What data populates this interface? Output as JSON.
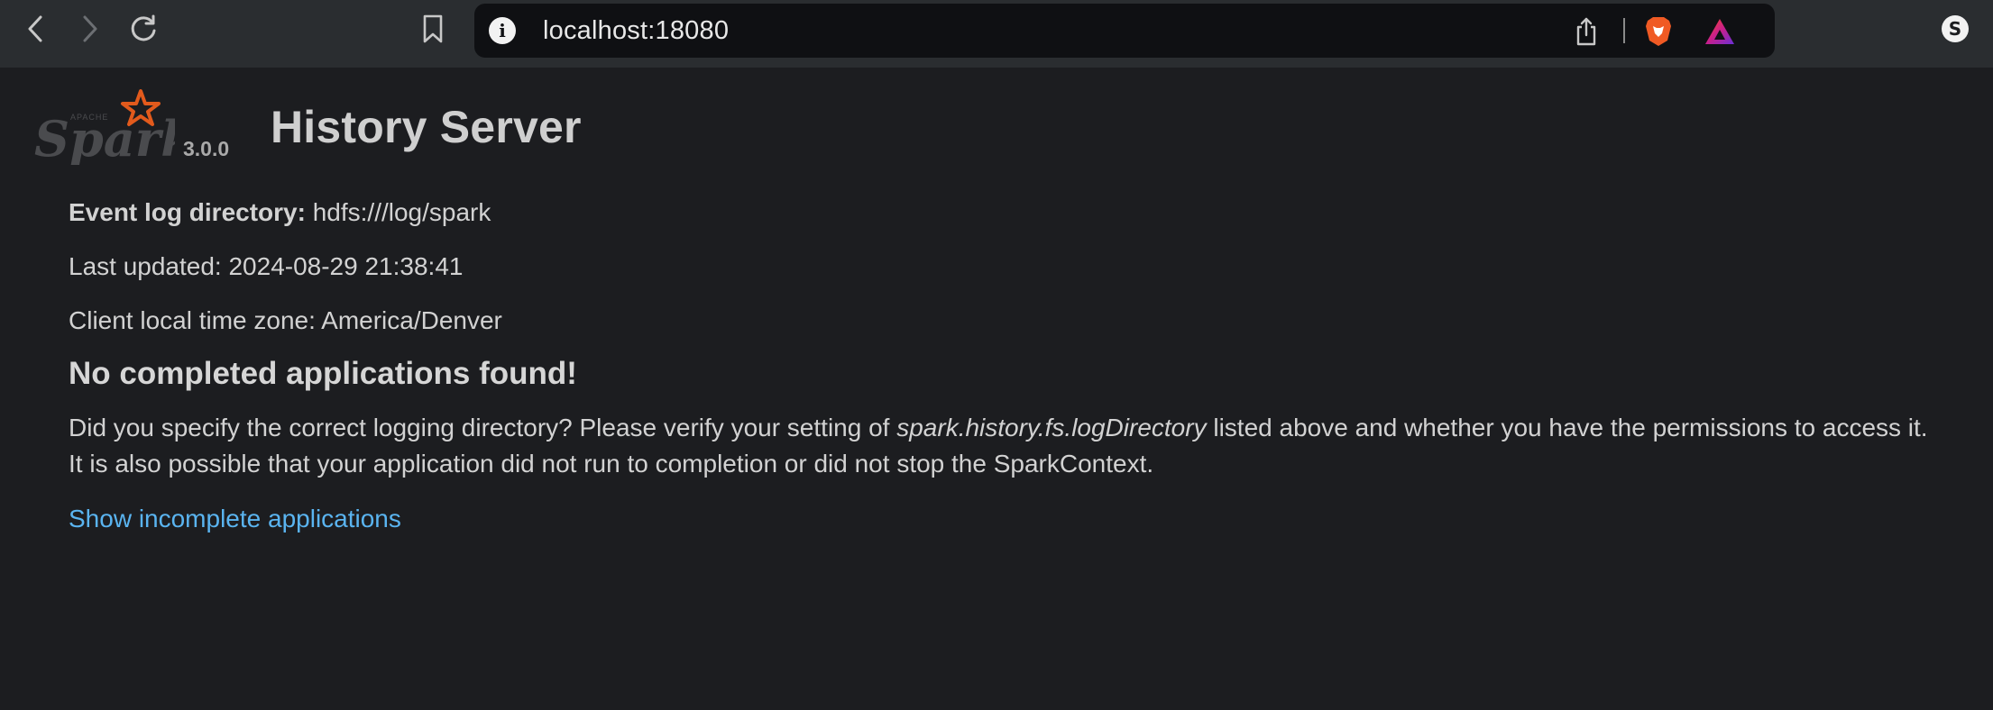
{
  "browser": {
    "url": "localhost:18080",
    "icons": [
      "back-icon",
      "forward-icon",
      "reload-icon",
      "bookmark-icon",
      "site-info-icon",
      "share-icon",
      "brave-shields-icon",
      "brave-rewards-icon",
      "profile-icon"
    ]
  },
  "header": {
    "logo_alt": "Apache Spark",
    "version": "3.0.0",
    "title": "History Server"
  },
  "info": {
    "event_log_label": "Event log directory:",
    "event_log_value": "hdfs:///log/spark",
    "last_updated": "Last updated: 2024-08-29 21:38:41",
    "time_zone": "Client local time zone: America/Denver"
  },
  "message": {
    "heading": "No completed applications found!",
    "para_part1": "Did you specify the correct logging directory? Please verify your setting of ",
    "para_italic": "spark.history.fs.logDirectory",
    "para_part2": " listed above and whether you have the permissions to access it.",
    "para_line2": "It is also possible that your application did not run to completion or did not stop the SparkContext."
  },
  "link": {
    "show_incomplete": "Show incomplete applications"
  },
  "colors": {
    "page_bg": "#1c1d20",
    "toolbar_bg": "#2a2d30",
    "link": "#5ab4f0",
    "spark_orange": "#e25a1c"
  }
}
